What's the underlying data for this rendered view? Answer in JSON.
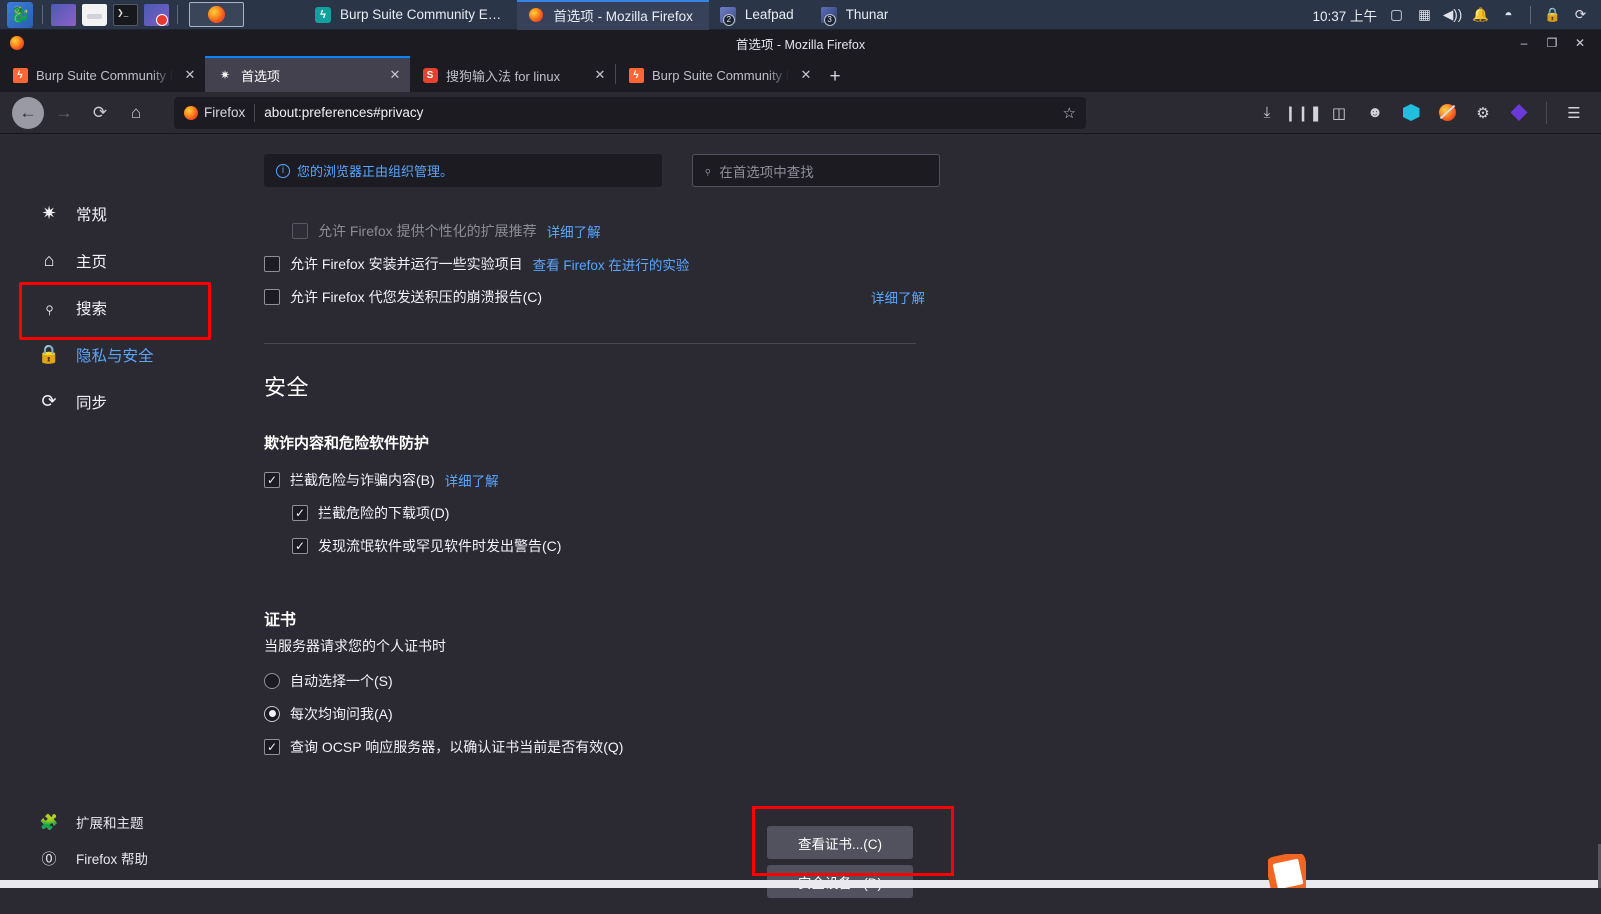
{
  "taskbar": {
    "launcher_icons": [
      {
        "name": "kali-menu-icon",
        "glyph": "❁"
      },
      {
        "name": "files-app-icon",
        "glyph": ""
      },
      {
        "name": "file-manager-icon",
        "glyph": ""
      },
      {
        "name": "terminal-icon",
        "glyph": ""
      },
      {
        "name": "screen-recorder-icon",
        "glyph": ""
      }
    ],
    "active_launcher": {
      "name": "firefox-launcher",
      "label": ""
    },
    "windows": [
      {
        "label": "Burp Suite Community E…",
        "icon": "burp-icon",
        "badge": "",
        "focused": false
      },
      {
        "label": "首选项 - Mozilla Firefox",
        "icon": "firefox-icon",
        "badge": "",
        "focused": true
      },
      {
        "label": "Leafpad",
        "icon": "leafpad-icon",
        "badge": "2",
        "focused": false
      },
      {
        "label": "Thunar",
        "icon": "thunar-icon",
        "badge": "3",
        "focused": false
      }
    ],
    "clock": "10:37 上午",
    "tray": [
      {
        "name": "display-icon",
        "glyph": "▢"
      },
      {
        "name": "keyboard-icon",
        "glyph": "▤"
      },
      {
        "name": "volume-icon",
        "glyph": "🔊"
      },
      {
        "name": "notification-bell-icon",
        "glyph": "🔔"
      },
      {
        "name": "power-icon",
        "glyph": "◓"
      },
      {
        "name": "lock-icon",
        "glyph": "🔒"
      },
      {
        "name": "logout-icon",
        "glyph": "⟳"
      }
    ]
  },
  "window": {
    "title": "首选项 - Mozilla Firefox",
    "minimize": "–",
    "maximize": "❐",
    "close": "✕"
  },
  "tabs": [
    {
      "label": "Burp Suite Community Ed",
      "favicon": "burp-favicon",
      "active": false,
      "close": "✕"
    },
    {
      "label": "首选项",
      "favicon": "gear-favicon",
      "active": true,
      "close": "✕"
    },
    {
      "label": "搜狗输入法 for linux",
      "favicon": "sogou-favicon",
      "active": false,
      "close": "✕"
    },
    {
      "label": "Burp Suite Community Ed",
      "favicon": "burp-favicon",
      "active": false,
      "close": "✕"
    }
  ],
  "new_tab_glyph": "+",
  "navbar": {
    "back": "←",
    "forward": "→",
    "reload": "⟳",
    "home": "⌂",
    "url_brand": "Firefox",
    "url": "about:preferences#privacy",
    "bookmark_star": "☆",
    "tools": [
      {
        "name": "downloads-icon",
        "glyph": "⤓"
      },
      {
        "name": "library-icon",
        "glyph": "❙❙❚"
      },
      {
        "name": "sidebar-icon",
        "glyph": "◫"
      },
      {
        "name": "account-icon",
        "glyph": "☺"
      },
      {
        "name": "extension-hackbar-icon",
        "glyph": ""
      },
      {
        "name": "extension-foxyproxy-icon",
        "glyph": ""
      },
      {
        "name": "extension-settings-icon",
        "glyph": "⚙"
      },
      {
        "name": "extension-wappalyzer-icon",
        "glyph": ""
      },
      {
        "name": "app-menu-icon",
        "glyph": "☰"
      }
    ]
  },
  "sidebar": {
    "items": [
      {
        "label": "常规",
        "icon": "gear-icon",
        "glyph": "✷",
        "selected": false
      },
      {
        "label": "主页",
        "icon": "home-icon",
        "glyph": "⌂",
        "selected": false
      },
      {
        "label": "搜索",
        "icon": "search-icon",
        "glyph": "⌕",
        "selected": false
      },
      {
        "label": "隐私与安全",
        "icon": "lock-icon",
        "glyph": "🔒",
        "selected": true
      },
      {
        "label": "同步",
        "icon": "sync-icon",
        "glyph": "⟳",
        "selected": false
      }
    ],
    "bottom_items": [
      {
        "label": "扩展和主题",
        "icon": "puzzle-icon",
        "glyph": "🧩"
      },
      {
        "label": "Firefox 帮助",
        "icon": "help-icon",
        "glyph": "?"
      }
    ]
  },
  "notice": {
    "icon": "info-icon",
    "text": "您的浏览器正由组织管理。"
  },
  "search": {
    "icon": "search-icon",
    "placeholder": "在首选项中查找",
    "value": ""
  },
  "data_collection": {
    "rows": [
      {
        "label": "允许 Firefox 提供个性化的扩展推荐",
        "link": "详细了解",
        "checked": false,
        "disabled": true,
        "right_link": ""
      },
      {
        "label": "允许 Firefox 安装并运行一些实验项目",
        "link": "查看 Firefox 在进行的实验",
        "checked": false,
        "disabled": false,
        "right_link": ""
      },
      {
        "label": "允许 Firefox 代您发送积压的崩溃报告(C)",
        "link": "",
        "checked": false,
        "disabled": false,
        "right_link": "详细了解"
      }
    ]
  },
  "security": {
    "heading": "安全",
    "deceptive": {
      "heading": "欺诈内容和危险软件防护",
      "rows": [
        {
          "label": "拦截危险与诈骗内容(B)",
          "link": "详细了解",
          "checked": true,
          "indent": 0
        },
        {
          "label": "拦截危险的下载项(D)",
          "link": "",
          "checked": true,
          "indent": 1
        },
        {
          "label": "发现流氓软件或罕见软件时发出警告(C)",
          "link": "",
          "checked": true,
          "indent": 1
        }
      ]
    },
    "certificates": {
      "heading": "证书",
      "subtext": "当服务器请求您的个人证书时",
      "radios": [
        {
          "label": "自动选择一个(S)",
          "selected": false
        },
        {
          "label": "每次均询问我(A)",
          "selected": true
        }
      ],
      "ocsp": {
        "label": "查询 OCSP 响应服务器，以确认证书当前是否有效(Q)",
        "checked": true
      },
      "buttons": [
        {
          "label": "查看证书...(C)",
          "highlighted": true
        },
        {
          "label": "安全设备...(D)",
          "highlighted": false
        }
      ]
    }
  },
  "annotations": {
    "highlight_color": "#ff0000",
    "boxes": [
      "sidebar-privacy-security",
      "view-certificates-button"
    ]
  }
}
